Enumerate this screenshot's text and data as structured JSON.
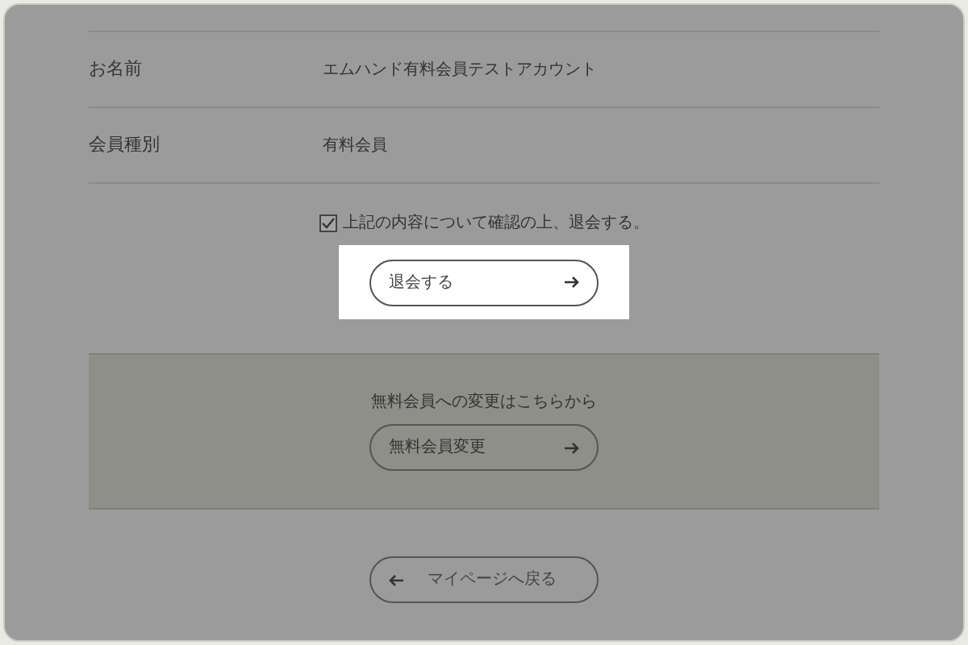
{
  "profile_rows": [
    {
      "label": "お名前",
      "value": "エムハンド有料会員テストアカウント"
    },
    {
      "label": "会員種別",
      "value": "有料会員"
    }
  ],
  "confirm": {
    "label": "上記の内容について確認の上、退会する。",
    "checked": true
  },
  "withdraw_button": {
    "label": "退会する"
  },
  "upgrade_panel": {
    "message": "無料会員への変更はこちらから",
    "button": "無料会員変更"
  },
  "back_button": {
    "label": "マイページへ戻る"
  }
}
